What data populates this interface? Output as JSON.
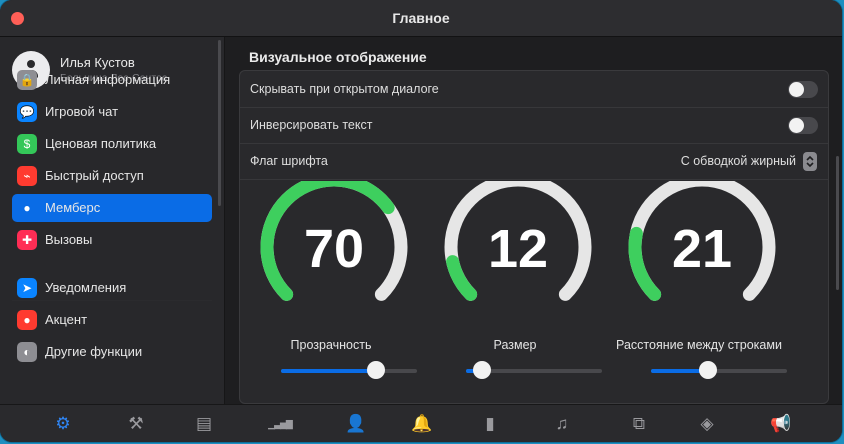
{
  "window": {
    "title": "Главное"
  },
  "profile": {
    "name": "Илья Кустов",
    "subtitle": "Больница Лос-Сантос"
  },
  "sidebar": {
    "items": [
      {
        "label": "Личная информация",
        "icon": "lock-icon",
        "glyph": "🔒",
        "color": "#8e8e93",
        "active": false
      },
      {
        "label": "Игровой чат",
        "icon": "chat-bubble-icon",
        "glyph": "💬",
        "color": "#0a84ff",
        "active": false
      },
      {
        "label": "Ценовая политика",
        "icon": "money-stack-icon",
        "glyph": "$",
        "color": "#34c759",
        "active": false
      },
      {
        "label": "Быстрый доступ",
        "icon": "rss-icon",
        "glyph": "⌁",
        "color": "#ff3b30",
        "active": false
      },
      {
        "label": "Мемберс",
        "icon": "person-icon",
        "glyph": "●",
        "color": "#0a6ce6",
        "active": true
      },
      {
        "label": "Вызовы",
        "icon": "ambulance-icon",
        "glyph": "✚",
        "color": "#ff2d55",
        "active": false
      },
      {
        "label": "Уведомления",
        "icon": "paper-plane-icon",
        "glyph": "➤",
        "color": "#0a84ff",
        "active": false
      },
      {
        "label": "Акцент",
        "icon": "palette-icon",
        "glyph": "●",
        "color": "#ff3b30",
        "active": false
      },
      {
        "label": "Другие функции",
        "icon": "toggle-icon",
        "glyph": "◐",
        "color": "#8e8e93",
        "active": false
      }
    ]
  },
  "content": {
    "section_title": "Визуальное отображение",
    "rows": {
      "hide_on_dialog": {
        "label": "Скрывать при открытом диалоге",
        "enabled": false
      },
      "invert_text": {
        "label": "Инверсировать текст",
        "enabled": false
      },
      "font_flag": {
        "label": "Флаг шрифта",
        "value": "С обводкой жирный"
      }
    },
    "gauges": [
      {
        "id": "transparency",
        "label": "Прозрачность",
        "value": "70",
        "fraction": 0.7,
        "slider": 0.7
      },
      {
        "id": "size",
        "label": "Размер",
        "value": "12",
        "fraction": 0.12,
        "slider": 0.12
      },
      {
        "id": "line-spacing",
        "label": "Расстояние между строками",
        "value": "21",
        "fraction": 0.21,
        "slider": 0.42
      }
    ]
  },
  "bottom_tabs": [
    {
      "icon": "gear-icon",
      "glyph": "⚙",
      "active": true
    },
    {
      "icon": "hammer-icon",
      "glyph": "⚒",
      "active": false
    },
    {
      "icon": "book-icon",
      "glyph": "▤",
      "active": false
    },
    {
      "icon": "signal-bars-icon",
      "glyph": "▁▃▅▇",
      "active": false
    },
    {
      "icon": "add-person-icon",
      "glyph": "👤",
      "active": false
    },
    {
      "icon": "bell-icon",
      "glyph": "🔔",
      "active": false
    },
    {
      "icon": "bar-chart-icon",
      "glyph": "▮",
      "active": false
    },
    {
      "icon": "music-note-icon",
      "glyph": "♫",
      "active": false
    },
    {
      "icon": "crop-icon",
      "glyph": "⧉",
      "active": false
    },
    {
      "icon": "cube-icon",
      "glyph": "◈",
      "active": false
    },
    {
      "icon": "megaphone-icon",
      "glyph": "📢",
      "active": false
    }
  ],
  "colors": {
    "accent": "#0a6ce6",
    "gauge_fill": "#3ecf5e",
    "gauge_track": "#e6e6e6"
  }
}
